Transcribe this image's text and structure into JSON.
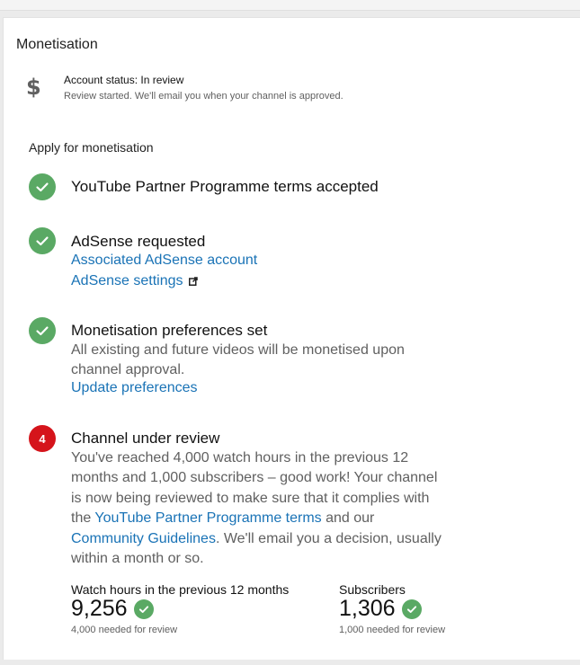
{
  "monetisation": {
    "title": "Monetisation",
    "account_status": "Account status: In review",
    "account_substatus": "Review started. We'll email you when your channel is approved.",
    "apply_heading": "Apply for monetisation",
    "steps": [
      {
        "title": "YouTube Partner Programme terms accepted",
        "state": "complete"
      },
      {
        "title": "AdSense requested",
        "state": "complete",
        "links": [
          "Associated AdSense account",
          "AdSense settings"
        ]
      },
      {
        "title": "Monetisation preferences set",
        "state": "complete",
        "description_line1": "All existing and future videos will be monetised upon",
        "description_line2": "channel approval.",
        "link": "Update preferences"
      },
      {
        "title": "Channel under review",
        "state": "in_progress",
        "number": "4",
        "desc_line1": "You've reached 4,000 watch hours in the previous 12",
        "desc_line2": "months and 1,000 subscribers – good work! Your channel",
        "desc_line3": "is now being reviewed to make sure that it complies with",
        "desc_line4_pre": "the ",
        "desc_line4_link": "YouTube Partner Programme terms",
        "desc_line4_post": " and our",
        "desc_line5_link": "Community Guidelines",
        "desc_line5_post": ". We'll email you a decision, usually",
        "desc_line6": "within a month or so."
      }
    ],
    "stats": [
      {
        "label": "Watch hours in the previous 12 months",
        "value": "9,256",
        "note": "4,000 needed for review"
      },
      {
        "label": "Subscribers",
        "value": "1,306",
        "note": "1,000 needed for review"
      }
    ]
  },
  "colors": {
    "success": "#5aa964",
    "alert": "#d5141b",
    "link": "#1a73b6"
  },
  "icons": {
    "account": "dollar-icon",
    "complete": "check-circle-icon",
    "external": "external-link-icon"
  }
}
